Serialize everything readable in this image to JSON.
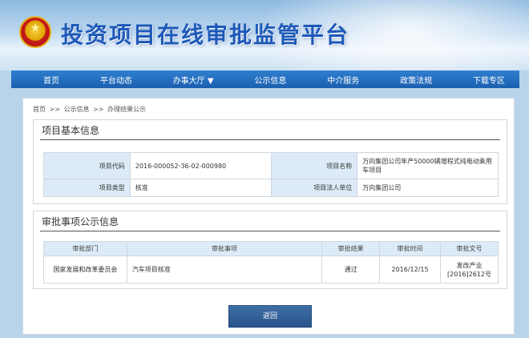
{
  "header": {
    "title": "投资项目在线审批监管平台",
    "emblem_icon": "national-emblem-icon"
  },
  "nav": {
    "items": [
      "首页",
      "平台动态",
      "办事大厅 ▼",
      "公示信息",
      "中介服务",
      "政策法规",
      "下载专区"
    ]
  },
  "breadcrumb": {
    "home": "首页",
    "sep": ">>",
    "level2": "公示信息",
    "level3": "办理结果公示"
  },
  "basic_info": {
    "title": "项目基本信息",
    "project_code_label": "项目代码",
    "project_code": "2016-000052-36-02-000980",
    "project_name_label": "项目名称",
    "project_name": "万向集团公司年产50000辆增程式纯电动乘用车项目",
    "project_type_label": "项目类型",
    "project_type": "核准",
    "legal_unit_label": "项目法人单位",
    "legal_unit": "万向集团公司"
  },
  "approval_info": {
    "title": "审批事项公示信息",
    "columns": [
      "审批部门",
      "审批事项",
      "审批结果",
      "审批时间",
      "审批文号"
    ],
    "rows": [
      {
        "department": "国家发展和改革委员会",
        "item": "汽车项目核准",
        "result": "通过",
        "date": "2016/12/15",
        "doc_no": "发改产业[2016]2612号"
      }
    ]
  },
  "actions": {
    "back_label": "返回"
  }
}
